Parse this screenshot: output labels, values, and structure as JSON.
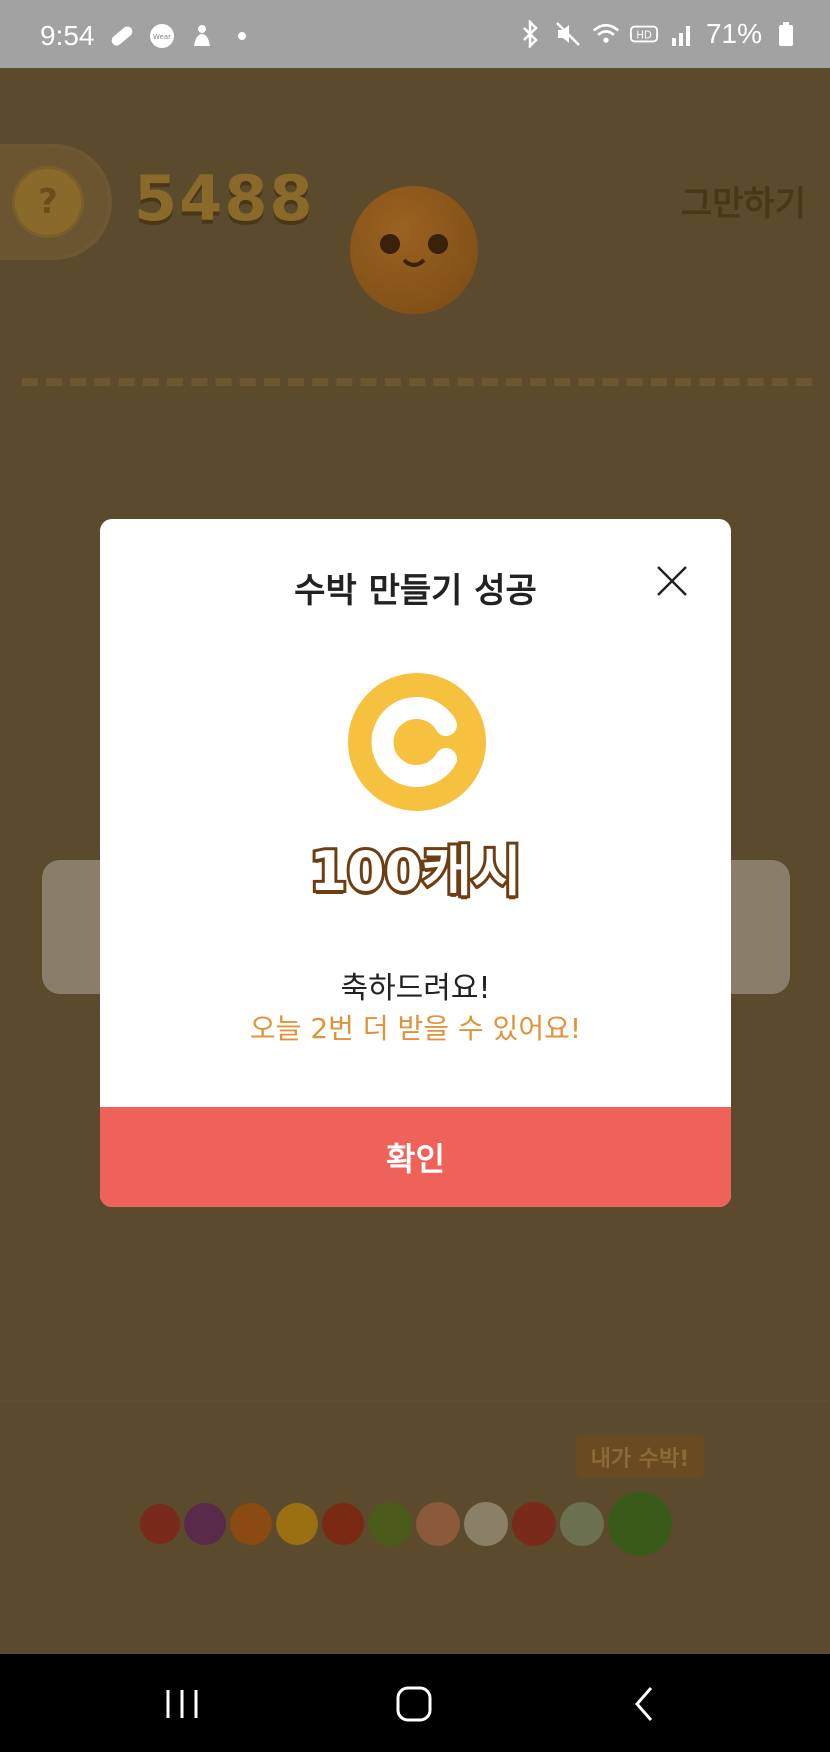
{
  "status_bar": {
    "time": "9:54",
    "left_icons": [
      "pill-icon",
      "wear-icon",
      "person-icon",
      "dot-icon"
    ],
    "wear_label": "Wear",
    "right_icons": [
      "bluetooth-icon",
      "mute-icon",
      "wifi-icon",
      "hd-icon",
      "signal-icon",
      "battery-icon"
    ],
    "hd_label": "HD",
    "battery": "71%"
  },
  "game": {
    "help_label": "?",
    "score": "5488",
    "quit_label": "그만하기",
    "tray_tag": "내가 수박!",
    "fruit_colors": [
      "#7a2a1a",
      "#5a2a4a",
      "#8a4a12",
      "#9a7012",
      "#7a2a12",
      "#4a5a1a",
      "#8a5a3a",
      "#8a8068",
      "#7a2a1a",
      "#6a7050",
      "#3a5a1a"
    ]
  },
  "modal": {
    "title": "수박 만들기 성공",
    "reward": "100캐시",
    "congrats": "축하드려요!",
    "remaining": "오늘 2번 더 받을 수 있어요!",
    "confirm": "확인"
  },
  "colors": {
    "overlay": "#5c4a2d",
    "coin": "#f6c13e",
    "reward_outline": "#6f3d12",
    "highlight_text": "#e0943a",
    "confirm_button": "#ef625a"
  }
}
